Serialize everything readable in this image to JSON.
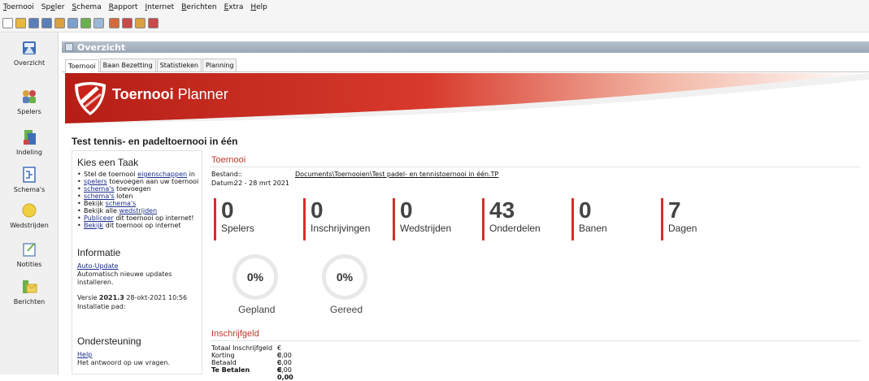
{
  "menu": [
    {
      "pre": "",
      "u": "T",
      "post": "oernooi"
    },
    {
      "pre": "Sp",
      "u": "e",
      "post": "ler"
    },
    {
      "pre": "",
      "u": "S",
      "post": "chema"
    },
    {
      "pre": "",
      "u": "R",
      "post": "apport"
    },
    {
      "pre": "",
      "u": "I",
      "post": "nternet"
    },
    {
      "pre": "",
      "u": "B",
      "post": "erichten"
    },
    {
      "pre": "",
      "u": "E",
      "post": "xtra"
    },
    {
      "pre": "",
      "u": "H",
      "post": "elp"
    }
  ],
  "toolbar": {
    "icons": [
      "new-icon",
      "open-icon",
      "tool-icon",
      "tool-icon",
      "tool-icon",
      "tool-icon",
      "tool-icon",
      "tool-icon",
      "user-icon",
      "users-icon",
      "tool-icon",
      "user-icon"
    ],
    "colors": [
      "#ffffff",
      "#e8b840",
      "#5a7fb8",
      "#5a7fb8",
      "#d9a040",
      "#7aa0d0",
      "#6ab04c",
      "#9bb8d8",
      "#d36a3a",
      "#c94a4a",
      "#d9a040",
      "#c94a4a"
    ]
  },
  "sidebar": [
    {
      "label": "Overzicht",
      "icon": "overview-icon"
    },
    {
      "label": "Spelers",
      "icon": "players-icon"
    },
    {
      "label": "Indeling",
      "icon": "layout-icon"
    },
    {
      "label": "Schema's",
      "icon": "schema-icon"
    },
    {
      "label": "Wedstrijden",
      "icon": "match-icon"
    },
    {
      "label": "Notities",
      "icon": "notes-icon"
    },
    {
      "label": "Berichten",
      "icon": "messages-icon"
    }
  ],
  "panel": {
    "title": "Overzicht"
  },
  "tabs": [
    "Toernooi",
    "Baan Bezetting",
    "Statistieken",
    "Planning"
  ],
  "brand": {
    "bold": "Toernooi",
    "rest": " Planner"
  },
  "page_title": "Test tennis- en padeltoernooi in één",
  "taskbox": {
    "title": "Kies een Taak",
    "tasks": [
      {
        "pre": "Stel de toernooi ",
        "link": "eigenschappen",
        "post": " in"
      },
      {
        "pre": "",
        "link": "spelers",
        "post": " toevoegen aan uw toernooi"
      },
      {
        "pre": "",
        "link": "schema's",
        "post": " toevoegen"
      },
      {
        "pre": "",
        "link": "schema's",
        "post": " loten"
      },
      {
        "pre": "Bekijk ",
        "link": "schema's",
        "post": ""
      },
      {
        "pre": "Bekijk alle ",
        "link": "wedstrijden",
        "post": ""
      },
      {
        "pre": "",
        "link": "Publiceer",
        "post": " dit toernooi op internet!"
      },
      {
        "pre": "",
        "link": "Bekijk",
        "post": " dit toernooi op internet"
      }
    ],
    "info_title": "Informatie",
    "auto_update": "Auto-Update",
    "auto_update_text": "Automatisch nieuwe updates installeren.",
    "version_pre": "Versie ",
    "version": "2021.3",
    "version_date": " 28-okt-2021 10:56",
    "install_path": "Installatie pad:",
    "support_title": "Ondersteuning",
    "help": "Help",
    "help_text": "Het antwoord op uw vragen."
  },
  "tournament": {
    "title": "Toernooi",
    "file_label": "Bestand:",
    "file_prefix": ":",
    "file_path": "Documents\\Toernooien\\Test padel- en tennistoernooi in één.TP",
    "date_label": "Datum:",
    "date": "22 - 28 mrt 2021"
  },
  "stats": [
    {
      "value": "0",
      "label": "Spelers"
    },
    {
      "value": "0",
      "label": "Inschrijvingen"
    },
    {
      "value": "0",
      "label": "Wedstrijden"
    },
    {
      "value": "43",
      "label": "Onderdelen"
    },
    {
      "value": "0",
      "label": "Banen"
    },
    {
      "value": "7",
      "label": "Dagen"
    }
  ],
  "gauges": [
    {
      "value": "0%",
      "label": "Gepland",
      "fraction": 0
    },
    {
      "value": "0%",
      "label": "Gereed",
      "fraction": 0
    }
  ],
  "fees": {
    "title": "Inschrijfgeld",
    "rows": [
      {
        "label": "Totaal Inschrijfgeld",
        "value": "€ 0,00"
      },
      {
        "label": "Korting",
        "value": "€ 0,00"
      },
      {
        "label": "Betaald",
        "value": "€ 0,00"
      },
      {
        "label": "Te Betalen",
        "value": "€ 0,00"
      }
    ]
  },
  "colors": {
    "accent": "#d3302a",
    "banner_start": "#c0221a",
    "banner_end": "#f0a090"
  }
}
